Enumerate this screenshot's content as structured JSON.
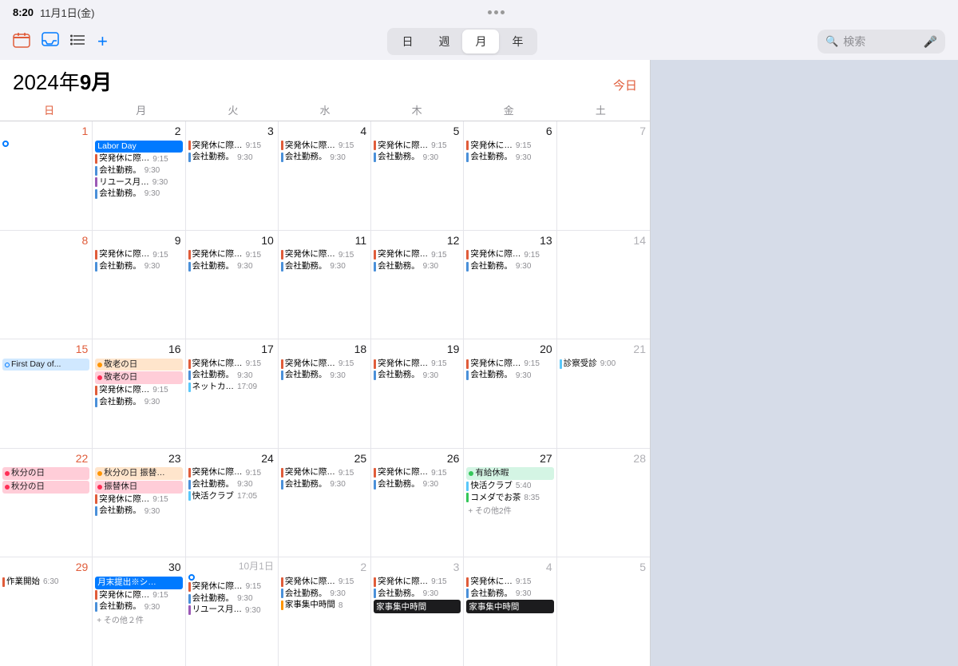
{
  "statusBar": {
    "time": "8:20",
    "date": "11月1日(金)"
  },
  "toolbar": {
    "viewTabs": [
      "日",
      "週",
      "月",
      "年"
    ],
    "activeTab": "月",
    "searchPlaceholder": "検索",
    "todayLabel": "今日"
  },
  "calendar": {
    "title": "2024年",
    "titleBold": "9月",
    "dayHeaders": [
      "日",
      "月",
      "火",
      "水",
      "木",
      "金",
      "土"
    ],
    "weeks": [
      {
        "cells": [
          {
            "num": "1",
            "type": "sunday",
            "events": [
              {
                "type": "dot-blue",
                "text": ""
              }
            ]
          },
          {
            "num": "2",
            "type": "normal",
            "events": [
              {
                "type": "bar-blue",
                "text": "Labor Day"
              },
              {
                "type": "line",
                "color": "#e05c3a",
                "text": "突発休に際…",
                "time": "9:15"
              },
              {
                "type": "line",
                "color": "#4a90d9",
                "text": "会社勤務。",
                "time": "9:30"
              },
              {
                "type": "line",
                "color": "#9b59b6",
                "text": "リユース月…",
                "time": "9:30"
              },
              {
                "type": "line",
                "color": "#4a90d9",
                "text": "会社勤務。",
                "time": "9:30"
              }
            ]
          },
          {
            "num": "3",
            "type": "normal",
            "events": [
              {
                "type": "line",
                "color": "#e05c3a",
                "text": "突発休に際…",
                "time": "9:15"
              },
              {
                "type": "line",
                "color": "#4a90d9",
                "text": "会社勤務。",
                "time": "9:30"
              }
            ]
          },
          {
            "num": "4",
            "type": "normal",
            "events": [
              {
                "type": "line",
                "color": "#e05c3a",
                "text": "突発休に際…",
                "time": "9:15"
              },
              {
                "type": "line",
                "color": "#4a90d9",
                "text": "会社勤務。",
                "time": "9:30"
              }
            ]
          },
          {
            "num": "5",
            "type": "normal",
            "events": [
              {
                "type": "line",
                "color": "#e05c3a",
                "text": "突発休に際…",
                "time": "9:15"
              },
              {
                "type": "line",
                "color": "#4a90d9",
                "text": "会社勤務。",
                "time": "9:30"
              }
            ]
          },
          {
            "num": "6",
            "type": "friday",
            "events": [
              {
                "type": "line",
                "color": "#e05c3a",
                "text": "突発休に…",
                "time": "9:15"
              },
              {
                "type": "line",
                "color": "#4a90d9",
                "text": "会社勤務。",
                "time": "9:30"
              }
            ]
          },
          {
            "num": "7",
            "type": "saturday",
            "events": []
          }
        ]
      },
      {
        "cells": [
          {
            "num": "8",
            "type": "sunday",
            "events": []
          },
          {
            "num": "9",
            "type": "normal",
            "events": [
              {
                "type": "line",
                "color": "#e05c3a",
                "text": "突発休に際…",
                "time": "9:15"
              },
              {
                "type": "line",
                "color": "#4a90d9",
                "text": "会社勤務。",
                "time": "9:30"
              }
            ]
          },
          {
            "num": "10",
            "type": "normal",
            "events": [
              {
                "type": "line",
                "color": "#e05c3a",
                "text": "突発休に際…",
                "time": "9:15"
              },
              {
                "type": "line",
                "color": "#4a90d9",
                "text": "会社勤務。",
                "time": "9:30"
              }
            ]
          },
          {
            "num": "11",
            "type": "normal",
            "events": [
              {
                "type": "line",
                "color": "#e05c3a",
                "text": "突発休に際…",
                "time": "9:15"
              },
              {
                "type": "line",
                "color": "#4a90d9",
                "text": "会社勤務。",
                "time": "9:30"
              }
            ]
          },
          {
            "num": "12",
            "type": "normal",
            "events": [
              {
                "type": "line",
                "color": "#e05c3a",
                "text": "突発休に際…",
                "time": "9:15"
              },
              {
                "type": "line",
                "color": "#4a90d9",
                "text": "会社勤務。",
                "time": "9:30"
              }
            ]
          },
          {
            "num": "13",
            "type": "friday",
            "events": [
              {
                "type": "line",
                "color": "#e05c3a",
                "text": "突発休に際…",
                "time": "9:15"
              },
              {
                "type": "line",
                "color": "#4a90d9",
                "text": "会社勤務。",
                "time": "9:30"
              }
            ]
          },
          {
            "num": "14",
            "type": "saturday",
            "events": []
          }
        ]
      },
      {
        "cells": [
          {
            "num": "15",
            "type": "sunday",
            "events": [
              {
                "type": "bar-outline-blue",
                "text": "First Day of..."
              }
            ]
          },
          {
            "num": "16",
            "type": "normal",
            "events": [
              {
                "type": "bar-orange",
                "text": "敬老の日"
              },
              {
                "type": "bar-pink",
                "text": "敬老の日"
              },
              {
                "type": "line",
                "color": "#e05c3a",
                "text": "突発休に際…",
                "time": "9:15"
              },
              {
                "type": "line",
                "color": "#4a90d9",
                "text": "会社勤務。",
                "time": "9:30"
              }
            ]
          },
          {
            "num": "17",
            "type": "normal",
            "events": [
              {
                "type": "line",
                "color": "#e05c3a",
                "text": "突発休に際…",
                "time": "9:15"
              },
              {
                "type": "line",
                "color": "#4a90d9",
                "text": "会社勤務。",
                "time": "9:30"
              },
              {
                "type": "line",
                "color": "#5ac8fa",
                "text": "ネットカ…",
                "time": "17:09"
              }
            ]
          },
          {
            "num": "18",
            "type": "normal",
            "events": [
              {
                "type": "line",
                "color": "#e05c3a",
                "text": "突発休に際…",
                "time": "9:15"
              },
              {
                "type": "line",
                "color": "#4a90d9",
                "text": "会社勤務。",
                "time": "9:30"
              }
            ]
          },
          {
            "num": "19",
            "type": "normal",
            "events": [
              {
                "type": "line",
                "color": "#e05c3a",
                "text": "突発休に際…",
                "time": "9:15"
              },
              {
                "type": "line",
                "color": "#4a90d9",
                "text": "会社勤務。",
                "time": "9:30"
              }
            ]
          },
          {
            "num": "20",
            "type": "friday",
            "events": [
              {
                "type": "line",
                "color": "#e05c3a",
                "text": "突発休に際…",
                "time": "9:15"
              },
              {
                "type": "line",
                "color": "#4a90d9",
                "text": "会社勤務。",
                "time": "9:30"
              }
            ]
          },
          {
            "num": "21",
            "type": "saturday",
            "events": [
              {
                "type": "line",
                "color": "#5ac8fa",
                "text": "診察受診",
                "time": "9:00"
              }
            ]
          }
        ]
      },
      {
        "cells": [
          {
            "num": "22",
            "type": "sunday",
            "events": [
              {
                "type": "bar-pink",
                "text": "秋分の日"
              },
              {
                "type": "bar-pink",
                "text": "秋分の日"
              }
            ]
          },
          {
            "num": "23",
            "type": "normal",
            "events": [
              {
                "type": "bar-orange",
                "text": "秋分の日 振替…"
              },
              {
                "type": "bar-pink",
                "text": "振替休日"
              },
              {
                "type": "line",
                "color": "#e05c3a",
                "text": "突発休に際…",
                "time": "9:15"
              },
              {
                "type": "line",
                "color": "#4a90d9",
                "text": "会社勤務。",
                "time": "9:30"
              }
            ]
          },
          {
            "num": "24",
            "type": "normal",
            "events": [
              {
                "type": "line",
                "color": "#e05c3a",
                "text": "突発休に際…",
                "time": "9:15"
              },
              {
                "type": "line",
                "color": "#4a90d9",
                "text": "会社勤務。",
                "time": "9:30"
              },
              {
                "type": "line",
                "color": "#5ac8fa",
                "text": "快活クラブ",
                "time": "17:05"
              }
            ]
          },
          {
            "num": "25",
            "type": "normal",
            "events": [
              {
                "type": "line",
                "color": "#e05c3a",
                "text": "突発休に際…",
                "time": "9:15"
              },
              {
                "type": "line",
                "color": "#4a90d9",
                "text": "会社勤務。",
                "time": "9:30"
              }
            ]
          },
          {
            "num": "26",
            "type": "normal",
            "events": [
              {
                "type": "line",
                "color": "#e05c3a",
                "text": "突発休に際…",
                "time": "9:15"
              },
              {
                "type": "line",
                "color": "#4a90d9",
                "text": "会社勤務。",
                "time": "9:30"
              }
            ]
          },
          {
            "num": "27",
            "type": "friday",
            "events": [
              {
                "type": "bar-green",
                "text": "有給休暇"
              },
              {
                "type": "line",
                "color": "#5ac8fa",
                "text": "快活クラブ",
                "time": "5:40"
              },
              {
                "type": "line",
                "color": "#34c759",
                "text": "コメダでお茶",
                "time": "8:35"
              },
              {
                "type": "more",
                "text": "+ その他2件"
              }
            ]
          },
          {
            "num": "28",
            "type": "saturday",
            "events": []
          }
        ]
      },
      {
        "cells": [
          {
            "num": "29",
            "type": "sunday",
            "events": [
              {
                "type": "line",
                "color": "#e05c3a",
                "text": "作業開始",
                "time": "6:30"
              }
            ]
          },
          {
            "num": "30",
            "type": "normal",
            "events": [
              {
                "type": "bar-blue",
                "text": "月末提出※シ…"
              },
              {
                "type": "line",
                "color": "#e05c3a",
                "text": "突発休に際…",
                "time": "9:15"
              },
              {
                "type": "line",
                "color": "#4a90d9",
                "text": "会社勤務。",
                "time": "9:30"
              },
              {
                "type": "more",
                "text": "+ その他２件"
              }
            ]
          },
          {
            "num": "1",
            "type": "oct normal",
            "label": "10月1日",
            "events": [
              {
                "type": "dot-blue",
                "text": ""
              },
              {
                "type": "line",
                "color": "#e05c3a",
                "text": "突発休に際…",
                "time": "9:15"
              },
              {
                "type": "line",
                "color": "#4a90d9",
                "text": "会社勤務。",
                "time": "9:30"
              },
              {
                "type": "line",
                "color": "#9b59b6",
                "text": "リユース月…",
                "time": "9:30"
              }
            ]
          },
          {
            "num": "2",
            "type": "oct normal",
            "events": [
              {
                "type": "line",
                "color": "#e05c3a",
                "text": "突発休に際…",
                "time": "9:15"
              },
              {
                "type": "line",
                "color": "#4a90d9",
                "text": "会社勤務。",
                "time": "9:30"
              },
              {
                "type": "line",
                "color": "#ff9500",
                "text": "家事集中時間",
                "time": "8"
              }
            ]
          },
          {
            "num": "3",
            "type": "oct normal",
            "events": [
              {
                "type": "line",
                "color": "#e05c3a",
                "text": "突発休に際…",
                "time": "9:15"
              },
              {
                "type": "line",
                "color": "#4a90d9",
                "text": "会社勤務。",
                "time": "9:30"
              },
              {
                "type": "bar-black",
                "text": "家事集中時間"
              }
            ]
          },
          {
            "num": "4",
            "type": "oct friday",
            "events": [
              {
                "type": "line",
                "color": "#e05c3a",
                "text": "突発休に…",
                "time": "9:15"
              },
              {
                "type": "line",
                "color": "#4a90d9",
                "text": "会社勤務。",
                "time": "9:30"
              },
              {
                "type": "bar-black",
                "text": "家事集中時間"
              }
            ]
          },
          {
            "num": "5",
            "type": "oct saturday",
            "events": []
          }
        ]
      }
    ]
  }
}
